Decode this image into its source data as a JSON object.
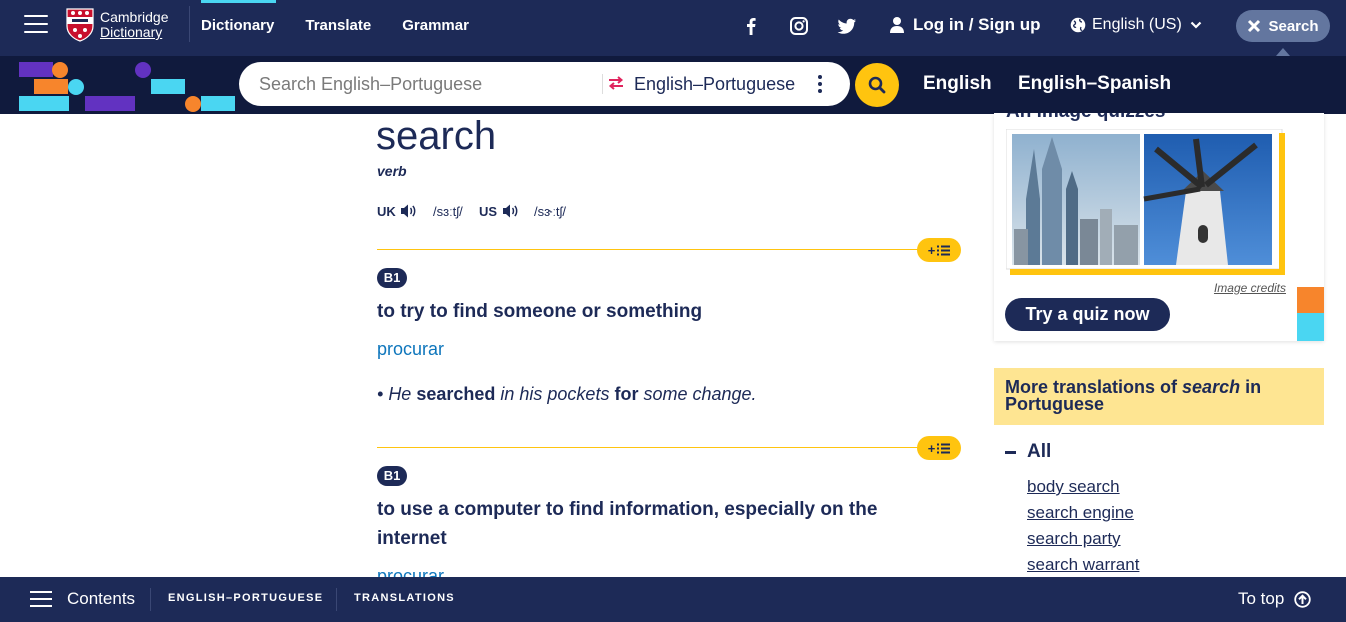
{
  "header": {
    "logo_line1": "Cambridge",
    "logo_line2": "Dictionary",
    "nav": [
      "Dictionary",
      "Translate",
      "Grammar"
    ],
    "login": "Log in / Sign up",
    "language": "English (US)",
    "search_button": "Search"
  },
  "searchbar": {
    "placeholder": "Search English–Portuguese",
    "dictionary": "English–Portuguese",
    "links": [
      "English",
      "English–Spanish"
    ]
  },
  "entry": {
    "headword": "search",
    "pos": "verb",
    "uk_label": "UK",
    "uk_ipa": "/sɜːtʃ/",
    "us_label": "US",
    "us_ipa": "/sɝːtʃ/",
    "senses": [
      {
        "level": "B1",
        "definition": "to try to find someone or something",
        "translation": "procurar",
        "example_parts": [
          "He ",
          "searched",
          " in his pockets ",
          "for",
          " some change."
        ]
      },
      {
        "level": "B1",
        "definition": "to use a computer to find information, especially on the internet",
        "translation": "procurar"
      }
    ],
    "plus_label": "+"
  },
  "sidebar": {
    "quiz_heading": "An image quizzes",
    "image_credits": "Image credits",
    "quiz_button": "Try a quiz now",
    "more_translations_prefix": "More translations of ",
    "more_translations_word": "search",
    "more_translations_suffix": " in Portuguese",
    "all_label": "All",
    "links": [
      "body search",
      "search engine",
      "search party",
      "search warrant"
    ]
  },
  "bottombar": {
    "contents": "Contents",
    "sections": [
      "ENGLISH–PORTUGUESE",
      "TRANSLATIONS"
    ],
    "to_top": "To top"
  },
  "colors": {
    "navy": "#1d2a57",
    "dark_navy": "#101a3d",
    "yellow": "#ffc40f",
    "link_blue": "#0e76bc",
    "cyan": "#4ad6f2",
    "orange": "#f7852c",
    "purple": "#6232c1"
  },
  "icons": [
    "menu-icon",
    "facebook-icon",
    "instagram-icon",
    "twitter-icon",
    "user-icon",
    "globe-icon",
    "chevron-down-icon",
    "close-icon",
    "swap-icon",
    "more-icon",
    "search-icon",
    "speaker-icon",
    "list-icon",
    "arrow-up-icon"
  ]
}
